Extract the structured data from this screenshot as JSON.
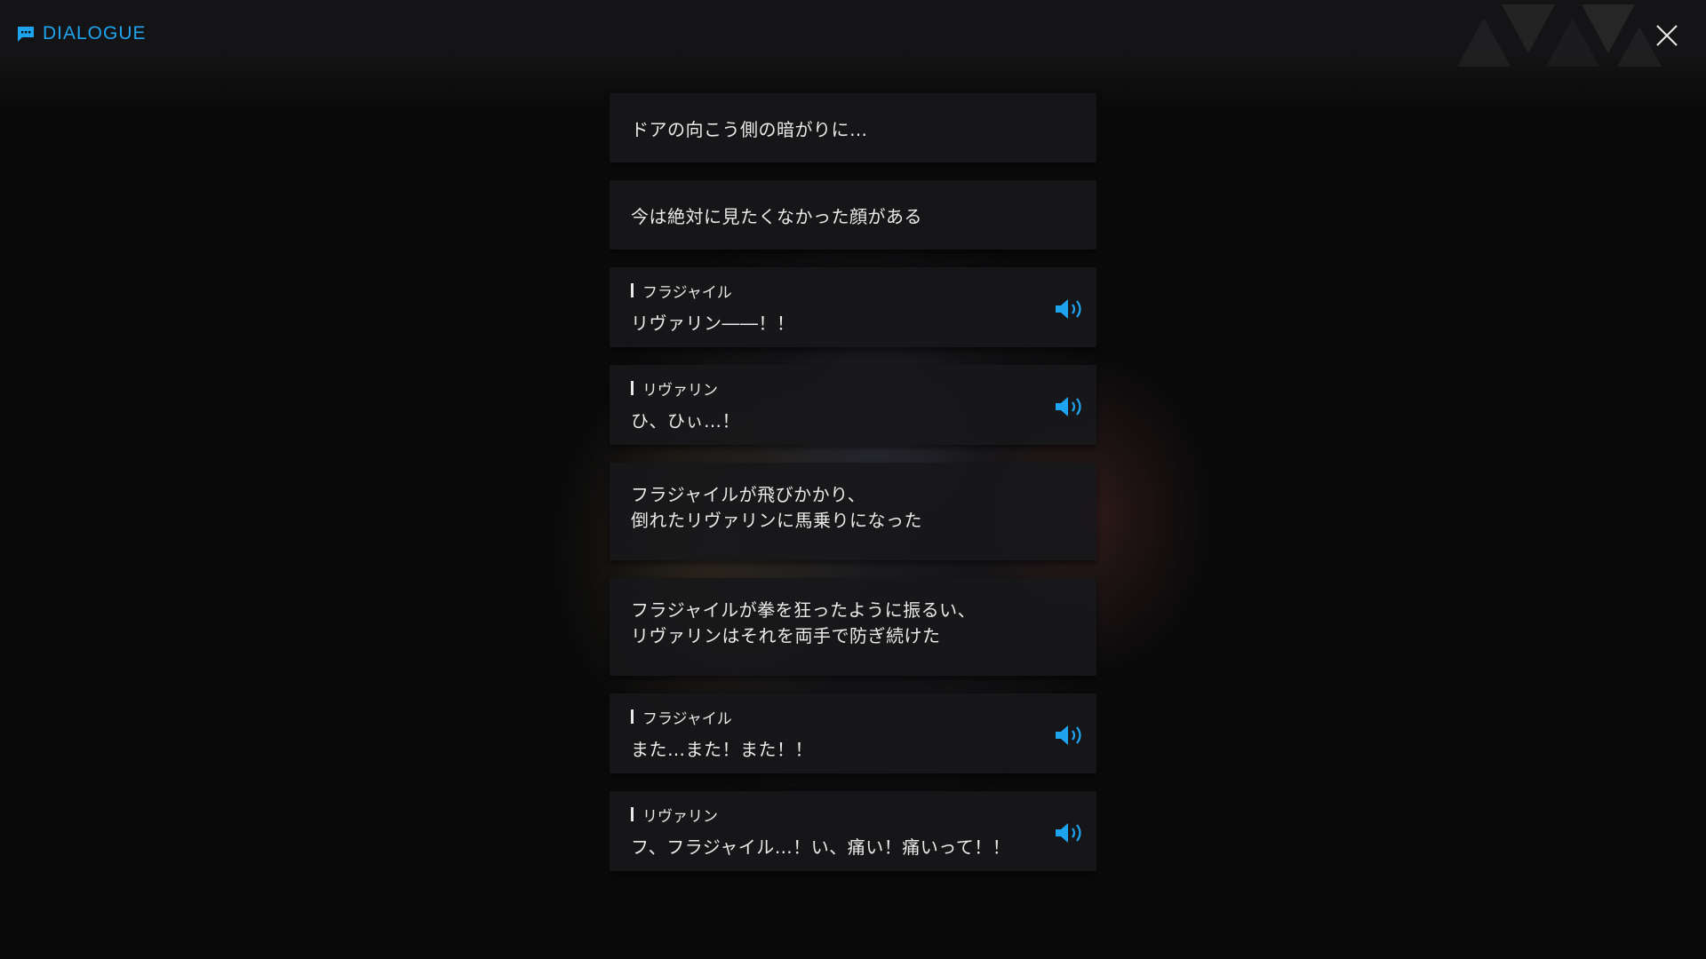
{
  "header": {
    "title": "DIALOGUE",
    "accent_color": "#1ea4ef",
    "chat_icon": "chat-bubble-icon",
    "close_icon": "close-icon"
  },
  "log": [
    {
      "kind": "narration",
      "text": "ドアの向こう側の暗がりに…"
    },
    {
      "kind": "narration",
      "text": "今は絶対に見たくなかった顔がある"
    },
    {
      "kind": "speech",
      "speaker": "フラジャイル",
      "text": "リヴァリン――！！",
      "voice_icon": "speaker-icon"
    },
    {
      "kind": "speech",
      "speaker": "リヴァリン",
      "text": "ひ、ひぃ…！",
      "voice_icon": "speaker-icon"
    },
    {
      "kind": "narration",
      "text": "フラジャイルが飛びかかり、\n倒れたリヴァリンに馬乗りになった"
    },
    {
      "kind": "narration",
      "text": "フラジャイルが拳を狂ったように振るい、\nリヴァリンはそれを両手で防ぎ続けた"
    },
    {
      "kind": "speech",
      "speaker": "フラジャイル",
      "text": "また…また！また！！",
      "voice_icon": "speaker-icon"
    },
    {
      "kind": "speech",
      "speaker": "リヴァリン",
      "text": "フ、フラジャイル…！い、痛い！痛いって！！",
      "voice_icon": "speaker-icon"
    }
  ]
}
